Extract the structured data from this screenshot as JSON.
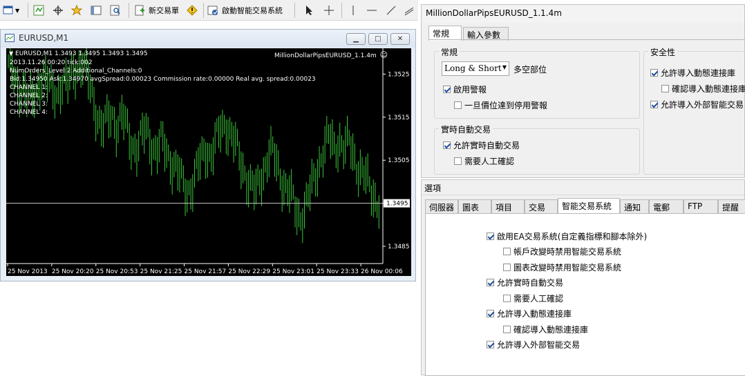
{
  "toolbar": {
    "new_order_label": "新交易單",
    "autotrading_label": "啟動智能交易系統"
  },
  "chart_window": {
    "title": "EURUSD,M1",
    "header": "EURUSD,M1  1.3493 1.3495 1.3493 1.3495",
    "expert_name": "MillionDollarPipsEURUSD_1.1.4m",
    "info_lines": [
      "2013.11.26 00:20 tick:002",
      "NumOrders_Level:2    Additional_Channels:0",
      "Bid:1.34950 Ask:1.34970 avgSpread:0.00023   Commission rate:0.00000   Real avg. spread:0.00023",
      "CHANNEL 1:",
      "CHANNEL 2:",
      "CHANNEL 3:",
      "CHANNEL 4:"
    ],
    "current_price": "1.3495",
    "colors": {
      "background": "#000000",
      "bars": "#3cc93c",
      "text": "#ffffff",
      "bid_line": "#c8c8c8"
    }
  },
  "chart_data": {
    "type": "line",
    "series_style": "bar (OHLC)",
    "x_tick_labels": [
      "25 Nov 2013",
      "25 Nov 20:20",
      "25 Nov 20:53",
      "25 Nov 21:25",
      "25 Nov 21:57",
      "25 Nov 22:29",
      "25 Nov 23:01",
      "25 Nov 23:33",
      "26 Nov 00:06"
    ],
    "y_tick_labels": [
      "1.3525",
      "1.3515",
      "1.3505",
      "1.3495",
      "1.3485"
    ],
    "ylim": [
      1.3481,
      1.3531
    ],
    "current_bid": 1.3495,
    "values": [
      1.3528,
      1.3524,
      1.3521,
      1.3523,
      1.352,
      1.3518,
      1.3522,
      1.3526,
      1.3523,
      1.352,
      1.3521,
      1.3524,
      1.3522,
      1.3525,
      1.3527,
      1.3528,
      1.3524,
      1.352,
      1.3516,
      1.3512,
      1.3514,
      1.3516,
      1.3513,
      1.3515,
      1.3512,
      1.3509,
      1.3508,
      1.351,
      1.3512,
      1.3509,
      1.3507,
      1.3509,
      1.3507,
      1.3505,
      1.3503,
      1.35,
      1.3498,
      1.3499,
      1.3502,
      1.3505,
      1.3508,
      1.3506,
      1.3509,
      1.3512,
      1.3514,
      1.3511,
      1.3508,
      1.3505,
      1.3502,
      1.3499,
      1.3497,
      1.3501,
      1.3504,
      1.3507,
      1.3505,
      1.3502,
      1.3499,
      1.3497,
      1.3494,
      1.3492,
      1.3494,
      1.3497,
      1.3501,
      1.3505,
      1.3508,
      1.351,
      1.3508,
      1.351,
      1.3507,
      1.3509,
      1.3506,
      1.3503,
      1.3501,
      1.3499,
      1.3497,
      1.3495
    ]
  },
  "ea_dialog": {
    "title": "MillionDollarPipsEURUSD_1.1.4m",
    "tabs": [
      "常規",
      "輸入參數"
    ],
    "group_general": "常規",
    "position_select": "Long & Short",
    "position_label": "多空部位",
    "enable_alerts": "啟用警報",
    "disable_alert_once": "一旦價位達到停用警報",
    "group_live": "實時自動交易",
    "allow_live": "允許實時自動交易",
    "manual_confirm": "需要人工確認",
    "group_safety": "安全性",
    "allow_dll": "允許導入動態連接庫",
    "confirm_dll": "確認導入動態連接庫",
    "allow_external": "允許導入外部智能交易"
  },
  "options_dialog": {
    "title": "選項",
    "tabs": [
      "伺服器",
      "圖表",
      "項目",
      "交易",
      "智能交易系統",
      "通知",
      "電郵",
      "FTP",
      "提醒"
    ],
    "enable_ea": "啟用EA交易系統(自定義指標和腳本除外)",
    "disable_account_change": "帳戶改變時禁用智能交易系統",
    "disable_chart_change": "圖表改變時禁用智能交易系統",
    "allow_live": "允許實時自動交易",
    "manual_confirm": "需要人工確認",
    "allow_dll": "允許導入動態連接庫",
    "confirm_dll": "確認導入動態連接庫",
    "allow_external": "允許導入外部智能交易"
  }
}
